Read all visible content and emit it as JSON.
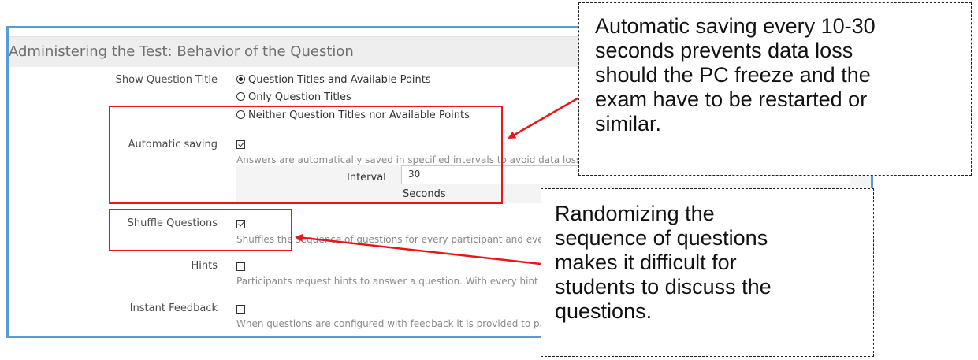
{
  "section": {
    "title": "Administering the Test: Behavior of the Question"
  },
  "show_question_title": {
    "label": "Show Question Title",
    "options": [
      {
        "label": "Question Titles and Available Points",
        "selected": true
      },
      {
        "label": "Only Question Titles",
        "selected": false
      },
      {
        "label": "Neither Question Titles nor Available Points",
        "selected": false
      }
    ]
  },
  "automatic_saving": {
    "label": "Automatic saving",
    "checked": true,
    "help": "Answers are automatically saved in specified intervals to avoid data loss.",
    "interval_label": "Interval",
    "interval_value": "30",
    "interval_unit": "Seconds"
  },
  "shuffle_questions": {
    "label": "Shuffle Questions",
    "checked": true,
    "help": "Shuffles the sequence of questions for every participant and every test pass."
  },
  "hints": {
    "label": "Hints",
    "checked": false,
    "help": "Participants request hints to answer a question. With every hint presented, they lose points."
  },
  "instant_feedback": {
    "label": "Instant Feedback",
    "checked": false,
    "help": "When questions are configured with feedback it is provided to participants immediately."
  },
  "callouts": {
    "saving_lines": [
      "Automatic saving every 10-30",
      "seconds prevents data loss",
      "should the PC freeze and the",
      "exam have to be restarted or",
      "similar."
    ],
    "shuffle_lines": [
      "Randomizing the",
      "sequence of questions",
      "makes it difficult for",
      "students to discuss the",
      "questions."
    ]
  },
  "colors": {
    "frame": "#5b9bd5",
    "highlight": "#e8161b",
    "arrow": "#e8161b"
  }
}
